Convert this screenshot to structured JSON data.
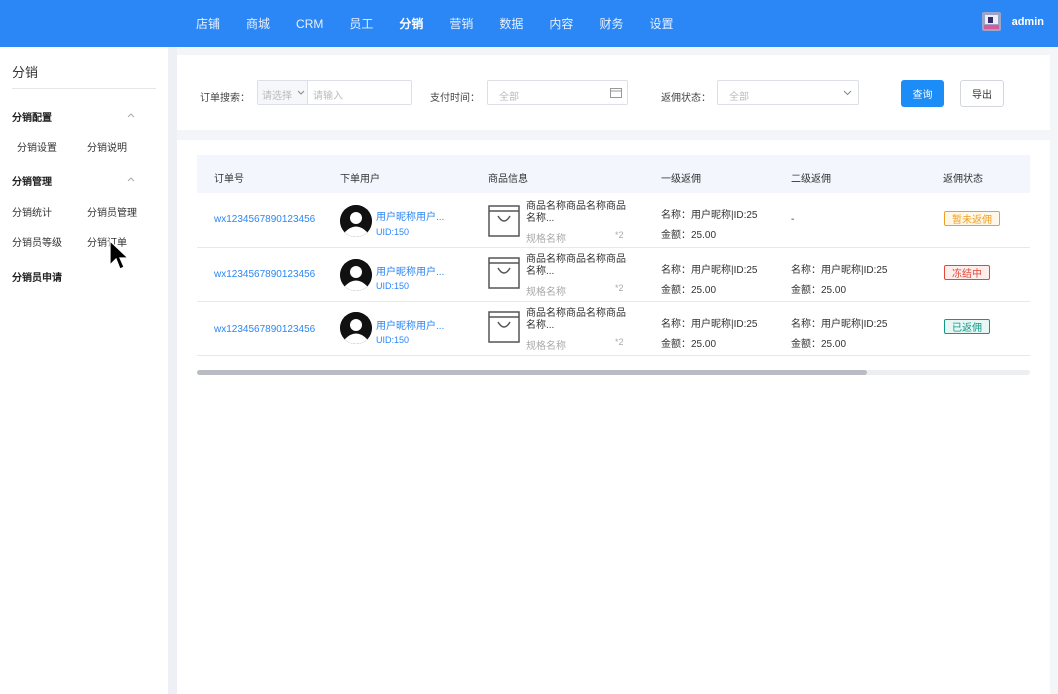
{
  "topnav": {
    "items": [
      "店铺",
      "商城",
      "CRM",
      "员工",
      "分销",
      "营销",
      "数据",
      "内容",
      "财务",
      "设置"
    ],
    "active_index": 4
  },
  "user": {
    "name": "admin"
  },
  "sidebar": {
    "title": "分销",
    "groups": [
      {
        "label": "分销配置",
        "items": [
          "分销设置",
          "分销说明"
        ]
      },
      {
        "label": "分销管理",
        "items": [
          "分销统计",
          "分销员管理",
          "分销员等级",
          "分销订单"
        ]
      },
      {
        "label": "分销员申请",
        "items": []
      }
    ]
  },
  "filter": {
    "order_search_label": "订单搜索：",
    "select_placeholder": "请选择",
    "input_placeholder": "请输入",
    "pay_time_label": "支付时间：",
    "pay_time_value": "全部",
    "status_label": "返佣状态：",
    "status_value": "全部",
    "query_label": "查询",
    "export_label": "导出"
  },
  "table": {
    "headers": [
      "订单号",
      "下单用户",
      "商品信息",
      "一级返佣",
      "二级返佣",
      "返佣状态"
    ],
    "rows": [
      {
        "order_no": "wx1234567890123456",
        "user_name": "用户昵称用户...",
        "uid": "UID:150",
        "product_name": "商品名称商品名称商品名称...",
        "spec": "规格名称",
        "qty": "*2",
        "level1_name": "名称：用户昵称|ID:25",
        "level1_amount": "金额：25.00",
        "level2_name": "-",
        "level2_amount": "",
        "status": "暂未返佣",
        "status_color": "#f0a020"
      },
      {
        "order_no": "wx1234567890123456",
        "user_name": "用户昵称用户...",
        "uid": "UID:150",
        "product_name": "商品名称商品名称商品名称...",
        "spec": "规格名称",
        "qty": "*2",
        "level1_name": "名称：用户昵称|ID:25",
        "level1_amount": "金额：25.00",
        "level2_name": "名称：用户昵称|ID:25",
        "level2_amount": "金额：25.00",
        "status": "冻结中",
        "status_color": "#e04a3a"
      },
      {
        "order_no": "wx1234567890123456",
        "user_name": "用户昵称用户...",
        "uid": "UID:150",
        "product_name": "商品名称商品名称商品名称...",
        "spec": "规格名称",
        "qty": "*2",
        "level1_name": "名称：用户昵称|ID:25",
        "level1_amount": "金额：25.00",
        "level2_name": "名称：用户昵称|ID:25",
        "level2_amount": "金额：25.00",
        "status": "已返佣",
        "status_color": "#0f9a86"
      }
    ]
  }
}
